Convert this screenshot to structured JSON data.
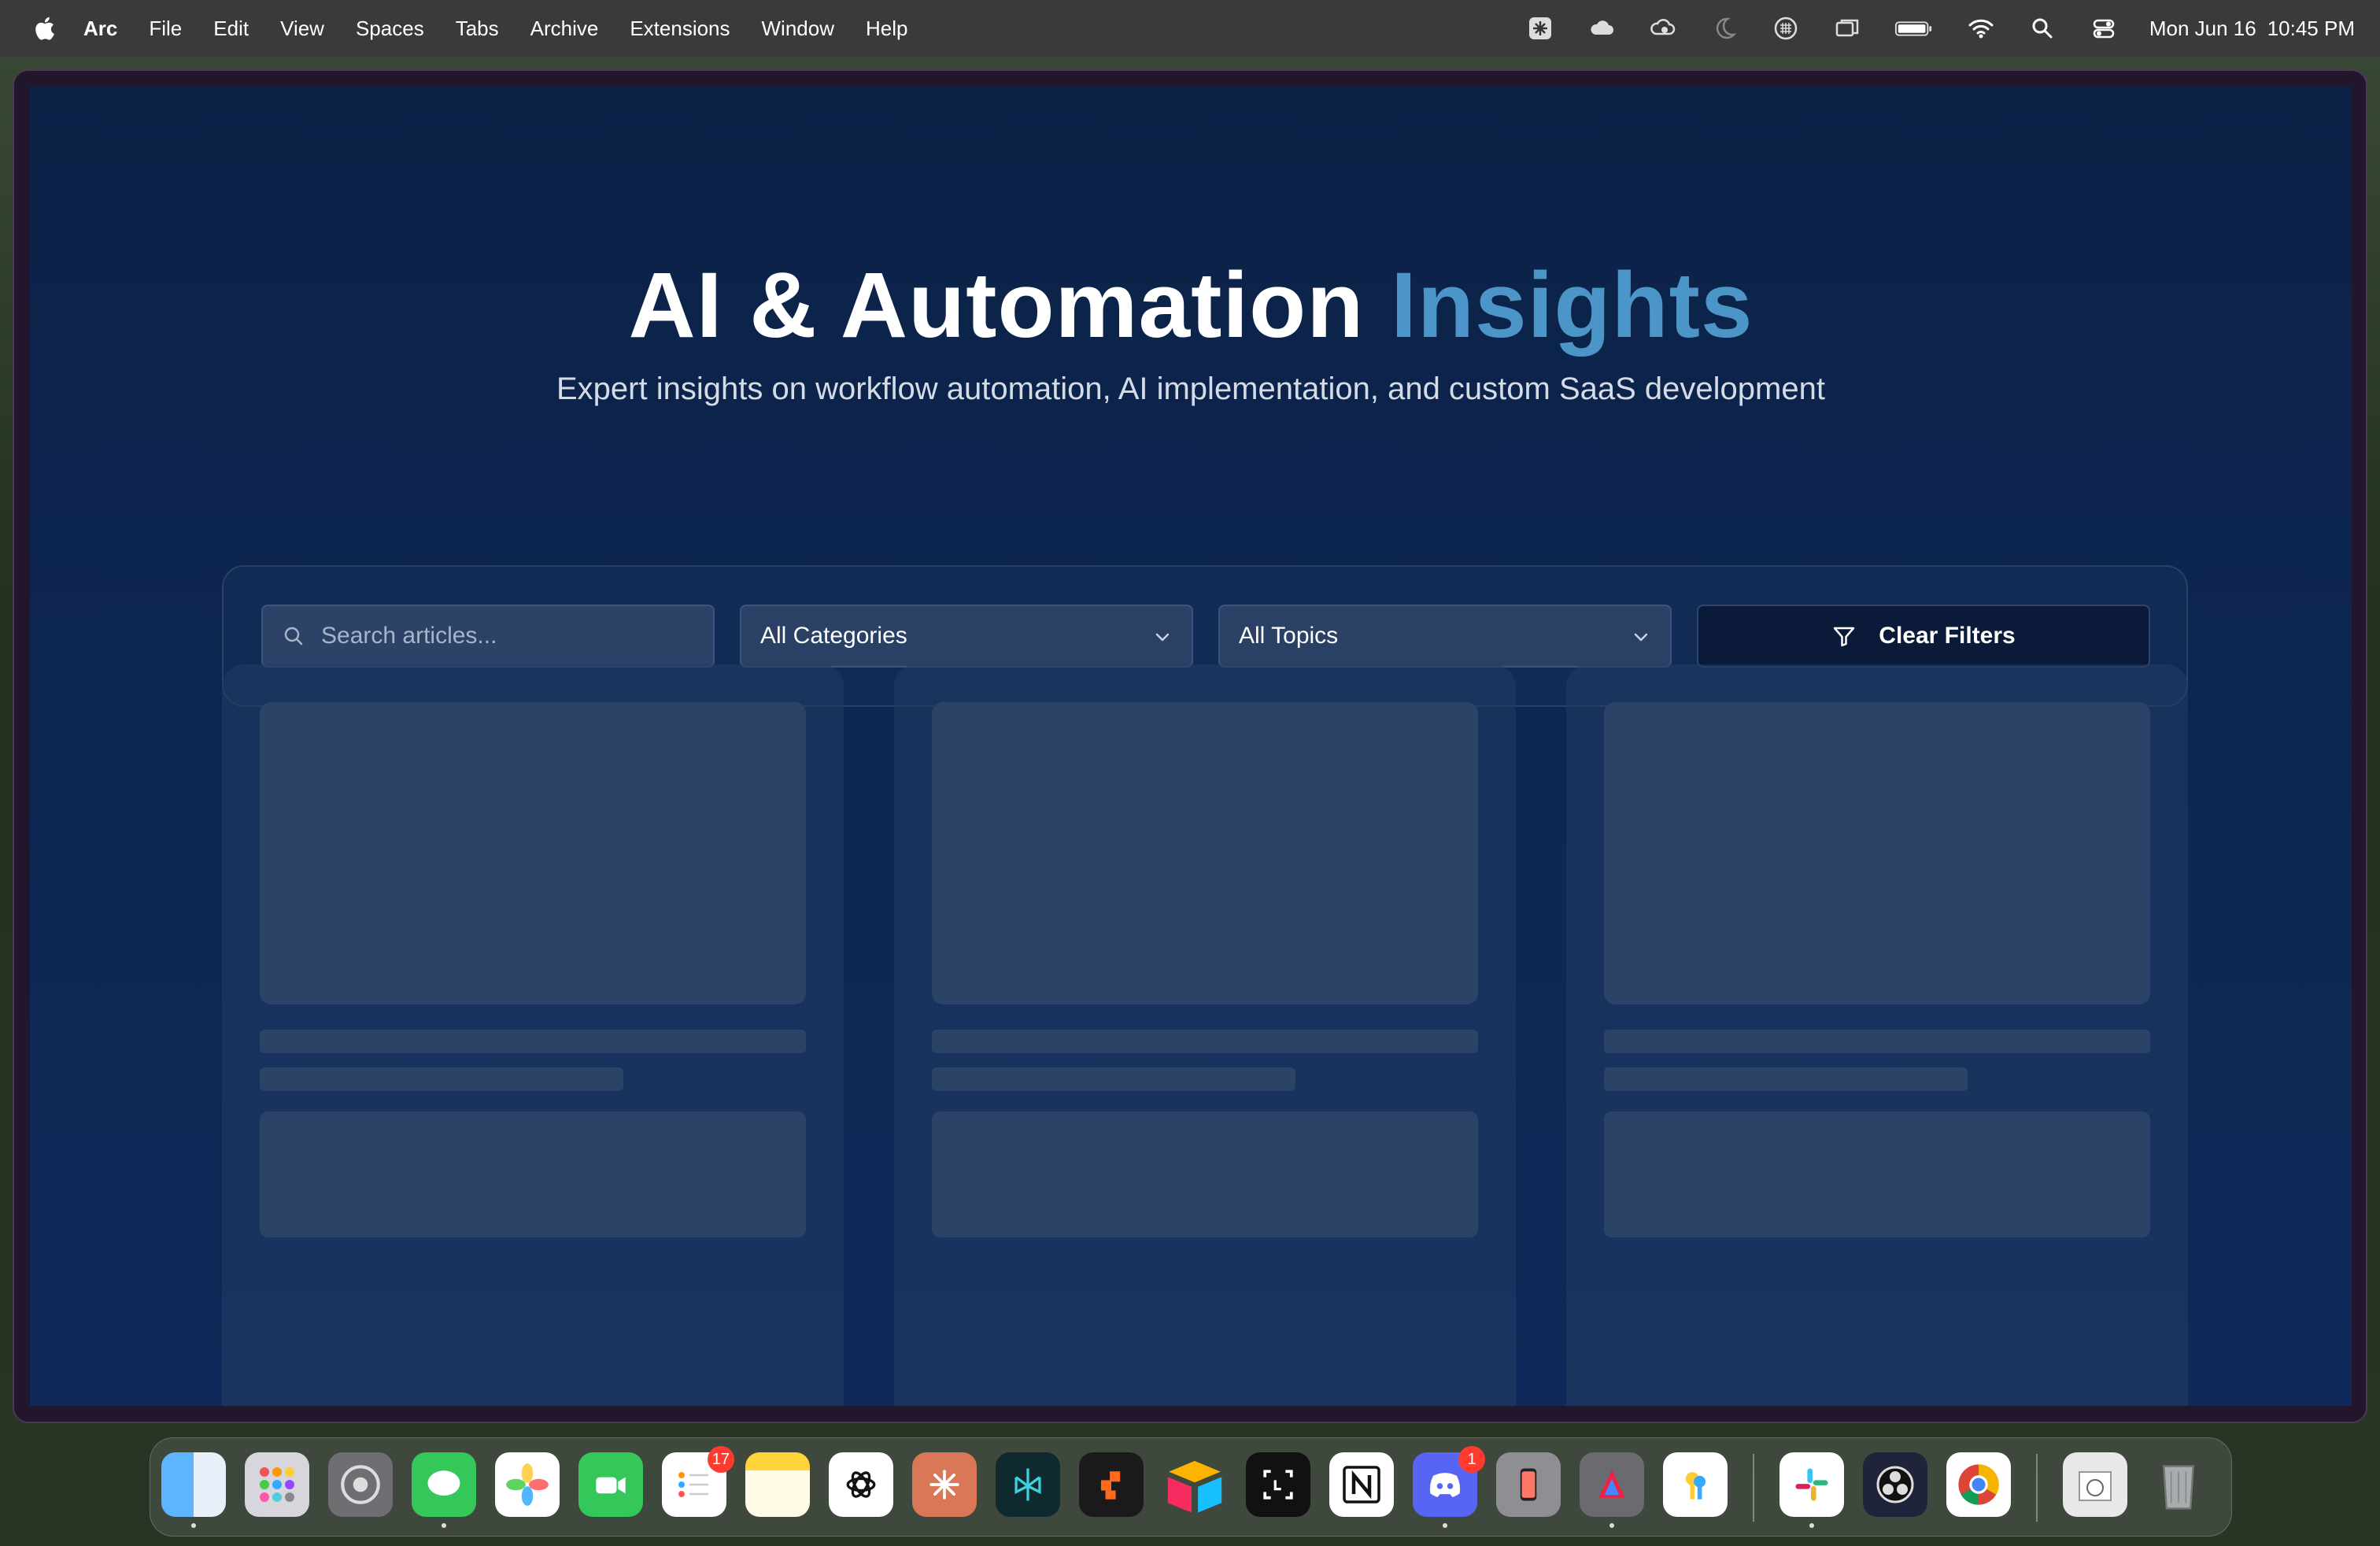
{
  "menubar": {
    "app_name": "Arc",
    "items": [
      "File",
      "Edit",
      "View",
      "Spaces",
      "Tabs",
      "Archive",
      "Extensions",
      "Window",
      "Help"
    ],
    "clock_date": "Mon Jun 16",
    "clock_time": "10:45 PM"
  },
  "page": {
    "title_main": "AI & Automation",
    "title_accent": "Insights",
    "subtitle": "Expert insights on workflow automation, AI implementation, and custom SaaS development"
  },
  "filters": {
    "search_placeholder": "Search articles...",
    "category_selected": "All Categories",
    "topic_selected": "All Topics",
    "clear_label": "Clear Filters"
  },
  "dock": {
    "reminders_badge": "17",
    "discord_badge": "1"
  },
  "colors": {
    "accent": "#4c95c8",
    "page_bg": "#0d2651"
  }
}
